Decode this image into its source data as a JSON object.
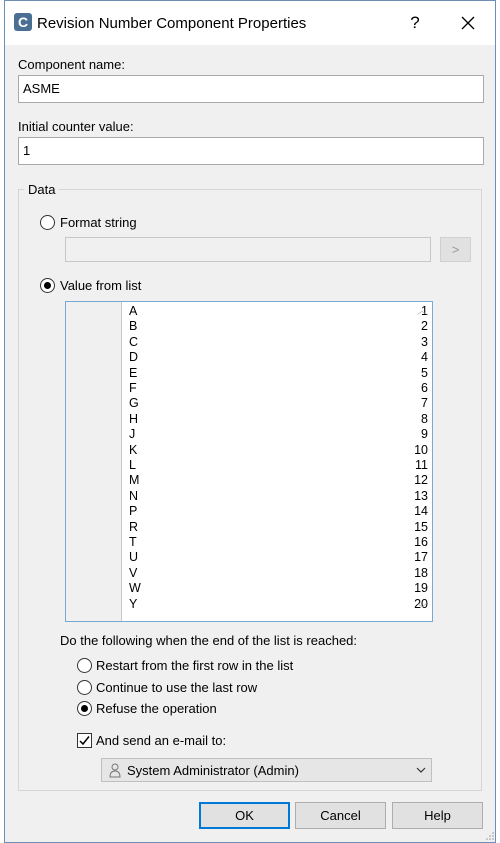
{
  "window": {
    "title": "Revision Number Component Properties",
    "app_icon_letter": "C",
    "help_label": "?",
    "close_label": "✕"
  },
  "component_name": {
    "label": "Component name:",
    "value": "ASME"
  },
  "initial_counter": {
    "label": "Initial counter value:",
    "value": "1"
  },
  "data_group": {
    "title": "Data",
    "format_string": {
      "label": "Format string",
      "selected": false,
      "value": "",
      "browse_label": ">"
    },
    "value_from_list": {
      "label": "Value from list",
      "selected": true,
      "rows": [
        {
          "n": "1",
          "v": "A"
        },
        {
          "n": "2",
          "v": "B"
        },
        {
          "n": "3",
          "v": "C"
        },
        {
          "n": "4",
          "v": "D"
        },
        {
          "n": "5",
          "v": "E"
        },
        {
          "n": "6",
          "v": "F"
        },
        {
          "n": "7",
          "v": "G"
        },
        {
          "n": "8",
          "v": "H"
        },
        {
          "n": "9",
          "v": "J"
        },
        {
          "n": "10",
          "v": "K"
        },
        {
          "n": "11",
          "v": "L"
        },
        {
          "n": "12",
          "v": "M"
        },
        {
          "n": "13",
          "v": "N"
        },
        {
          "n": "14",
          "v": "P"
        },
        {
          "n": "15",
          "v": "R"
        },
        {
          "n": "16",
          "v": "T"
        },
        {
          "n": "17",
          "v": "U"
        },
        {
          "n": "18",
          "v": "V"
        },
        {
          "n": "19",
          "v": "W"
        },
        {
          "n": "20",
          "v": "Y"
        }
      ]
    },
    "end_of_list": {
      "label": "Do the following when the end of the list is reached:",
      "options": [
        {
          "label": "Restart from the first row in the list",
          "selected": false
        },
        {
          "label": "Continue to use the last row",
          "selected": false
        },
        {
          "label": "Refuse the operation",
          "selected": true
        }
      ]
    },
    "send_email": {
      "label": "And send an e-mail to:",
      "checked": true,
      "recipient": "System Administrator (Admin)"
    }
  },
  "buttons": {
    "ok": "OK",
    "cancel": "Cancel",
    "help": "Help"
  },
  "colors": {
    "accent": "#0078d7",
    "list_border": "#7aa7d6",
    "app_icon": "#4a6f93"
  }
}
